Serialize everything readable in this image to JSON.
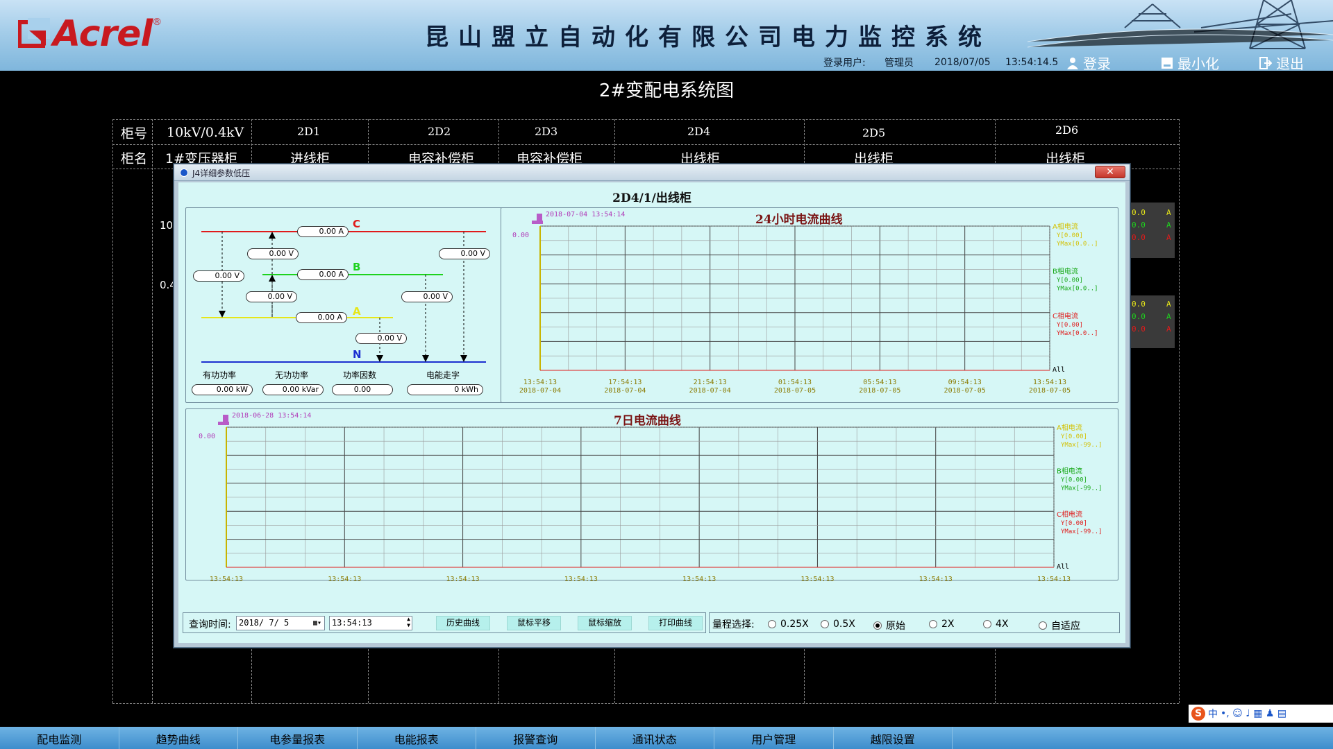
{
  "header": {
    "logo_text": "Acrel",
    "logo_reg": "®",
    "system_title": "昆山盟立自动化有限公司电力监控系统",
    "login_user_label": "登录用户:",
    "login_user_value": "管理员",
    "date": "2018/07/05",
    "time": "13:54:14.5",
    "login_button": "登录",
    "minimize_button": "最小化",
    "exit_button": "退出"
  },
  "page_title": "2#变配电系统图",
  "diagram": {
    "row1_label": "柜号",
    "row2_label": "柜名",
    "columns": [
      {
        "code": "10kV/0.4kV",
        "name": "1#变压器柜"
      },
      {
        "code": "2D1",
        "name": "进线柜"
      },
      {
        "code": "2D2",
        "name": "电容补偿柜"
      },
      {
        "code": "2D3",
        "name": "电容补偿柜"
      },
      {
        "code": "2D4",
        "name": "出线柜"
      },
      {
        "code": "2D5",
        "name": "出线柜"
      },
      {
        "code": "2D6",
        "name": "出线柜"
      }
    ],
    "side_label_10": "10",
    "side_label_04": "0.4",
    "right_vals_top": [
      "0.0",
      "0.0",
      "0.0"
    ],
    "right_vals_bot": [
      "0.0",
      "0.0",
      "0.0"
    ],
    "right_unit": "A"
  },
  "dialog": {
    "window_title": "J4详细参数低压",
    "heading": "2D4/1/出线柜",
    "close_label": "✕",
    "phase_labels": {
      "c": "C",
      "b": "B",
      "a": "A",
      "n": "N"
    },
    "phase_colors": {
      "c": "#e01b1b",
      "b": "#1ed21e",
      "a": "#e6e61a",
      "n": "#1b2fd0"
    },
    "currents": {
      "c": "0.00 A",
      "b": "0.00 A",
      "a": "0.00 A"
    },
    "voltages": {
      "ca": "0.00 V",
      "left": "0.00 V",
      "bc": "0.00 V",
      "ab": "0.00 V",
      "an": "0.00 V",
      "bn": "0.00 V",
      "cn": "0.00 V"
    },
    "metrics_labels": [
      "有功功率",
      "无功功率",
      "功率因数",
      "电能走字"
    ],
    "metrics_values": [
      "0.00 kW",
      "0.00 kVar",
      "0.00",
      "0 kWh"
    ],
    "chart24": {
      "title": "24小时电流曲线",
      "cursor_time": "2018-07-04 13:54:14",
      "y_value": "0.00",
      "x_labels": [
        [
          "13:54:13",
          "2018-07-04"
        ],
        [
          "17:54:13",
          "2018-07-04"
        ],
        [
          "21:54:13",
          "2018-07-04"
        ],
        [
          "01:54:13",
          "2018-07-05"
        ],
        [
          "05:54:13",
          "2018-07-05"
        ],
        [
          "09:54:13",
          "2018-07-05"
        ],
        [
          "13:54:13",
          "2018-07-05"
        ]
      ],
      "legend": [
        {
          "name": "A相电流",
          "y": "Y[0.00]",
          "ymax": "YMax[0.0..]",
          "color": "#d4c000"
        },
        {
          "name": "B相电流",
          "y": "Y[0.00]",
          "ymax": "YMax[0.0..]",
          "color": "#18a818"
        },
        {
          "name": "C相电流",
          "y": "Y[0.00]",
          "ymax": "YMax[0.0..]",
          "color": "#e01b1b"
        }
      ],
      "all_label": "All"
    },
    "chart7": {
      "title": "7日电流曲线",
      "cursor_time": "2018-06-28 13:54:14",
      "y_value": "0.00",
      "x_labels": [
        [
          "13:54:13",
          "2018-06-28"
        ],
        [
          "13:54:13",
          "2018-06-29"
        ],
        [
          "13:54:13",
          "2018-06-30"
        ],
        [
          "13:54:13",
          "2018-07-01"
        ],
        [
          "13:54:13",
          "2018-07-02"
        ],
        [
          "13:54:13",
          "2018-07-03"
        ],
        [
          "13:54:13",
          "2018-07-04"
        ],
        [
          "13:54:13",
          "2018-07-05"
        ]
      ],
      "legend": [
        {
          "name": "A相电流",
          "y": "Y[0.00]",
          "ymax": "YMax[-99..]",
          "color": "#d4c000"
        },
        {
          "name": "B相电流",
          "y": "Y[0.00]",
          "ymax": "YMax[-99..]",
          "color": "#18a818"
        },
        {
          "name": "C相电流",
          "y": "Y[0.00]",
          "ymax": "YMax[-99..]",
          "color": "#e01b1b"
        }
      ],
      "all_label": "All"
    },
    "query": {
      "label": "查询时间:",
      "date": "2018/ 7/ 5",
      "time": "13:54:13",
      "buttons": [
        "历史曲线",
        "鼠标平移",
        "鼠标缩放",
        "打印曲线"
      ]
    },
    "range": {
      "label": "量程选择:",
      "options": [
        "0.25X",
        "0.5X",
        "原始",
        "2X",
        "4X",
        "自适应"
      ],
      "selected": "原始"
    }
  },
  "chart_data": [
    {
      "type": "line",
      "title": "24小时电流曲线",
      "x": [
        "13:54:13 2018-07-04",
        "17:54:13 2018-07-04",
        "21:54:13 2018-07-04",
        "01:54:13 2018-07-05",
        "05:54:13 2018-07-05",
        "09:54:13 2018-07-05",
        "13:54:13 2018-07-05"
      ],
      "series": [
        {
          "name": "A相电流",
          "values": [
            0,
            0,
            0,
            0,
            0,
            0,
            0
          ]
        },
        {
          "name": "B相电流",
          "values": [
            0,
            0,
            0,
            0,
            0,
            0,
            0
          ]
        },
        {
          "name": "C相电流",
          "values": [
            0,
            0,
            0,
            0,
            0,
            0,
            0
          ]
        }
      ],
      "grid": true,
      "legend": "right"
    },
    {
      "type": "line",
      "title": "7日电流曲线",
      "x": [
        "13:54:13 2018-06-28",
        "13:54:13 2018-06-29",
        "13:54:13 2018-06-30",
        "13:54:13 2018-07-01",
        "13:54:13 2018-07-02",
        "13:54:13 2018-07-03",
        "13:54:13 2018-07-04",
        "13:54:13 2018-07-05"
      ],
      "series": [
        {
          "name": "A相电流",
          "values": [
            0,
            0,
            0,
            0,
            0,
            0,
            0,
            0
          ]
        },
        {
          "name": "B相电流",
          "values": [
            0,
            0,
            0,
            0,
            0,
            0,
            0,
            0
          ]
        },
        {
          "name": "C相电流",
          "values": [
            0,
            0,
            0,
            0,
            0,
            0,
            0,
            0
          ]
        }
      ],
      "grid": true,
      "legend": "right"
    }
  ],
  "navbar": [
    "配电监测",
    "趋势曲线",
    "电参量报表",
    "电能报表",
    "报警查询",
    "通讯状态",
    "用户管理",
    "越限设置"
  ],
  "ime_text": "中"
}
